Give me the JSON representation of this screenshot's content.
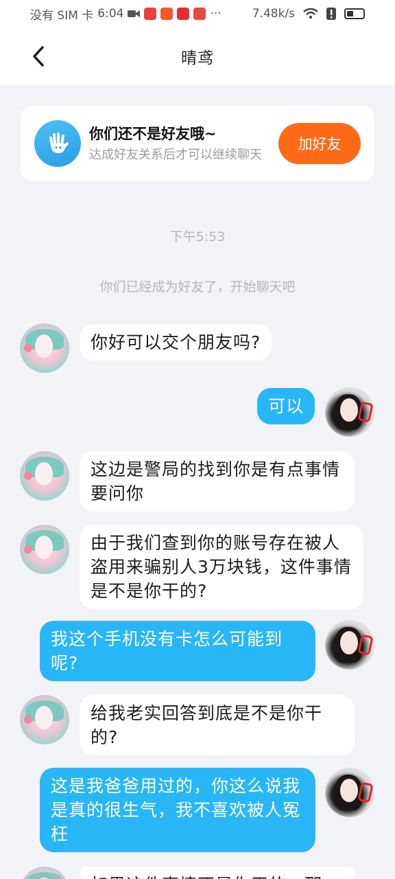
{
  "status_bar": {
    "carrier": "没有 SIM 卡",
    "time": "6:04",
    "network_speed": "7.48k/s",
    "app_icon_colors": [
      "#e8413c",
      "#f25a2c",
      "#e3302f",
      "#ea4a3d"
    ]
  },
  "header": {
    "title": "晴鸢",
    "back_icon": "chevron-left-icon"
  },
  "banner": {
    "title": "你们还不是好友哦~",
    "subtitle": "达成好友关系后才可以继续聊天",
    "button_label": "加好友",
    "icon": "waving-hand-icon",
    "accent": "#ff6a1a"
  },
  "system": {
    "timestamp": "下午5:53",
    "note": "你们已经成为好友了，开始聊天吧"
  },
  "messages": [
    {
      "side": "in",
      "text": "你好可以交个朋友吗?"
    },
    {
      "side": "out",
      "text": "可以"
    },
    {
      "side": "in",
      "text": "这边是警局的找到你是有点事情要问你"
    },
    {
      "side": "in",
      "text": "由于我们查到你的账号存在被人盗用来骗别人3万块钱，这件事情是不是你干的?"
    },
    {
      "side": "out",
      "text": "我这个手机没有卡怎么可能到呢?"
    },
    {
      "side": "in",
      "text": "给我老实回答到底是不是你干的?"
    },
    {
      "side": "out",
      "text": "这是我爸爸用过的，你这么说我是真的很生气，我不喜欢被人冤枉"
    },
    {
      "side": "in",
      "text": "如果这件事情不是你干的，那"
    }
  ],
  "colors": {
    "bubble_out": "#28b6f6",
    "bubble_in": "#ffffff",
    "background": "#f2f3f7"
  }
}
